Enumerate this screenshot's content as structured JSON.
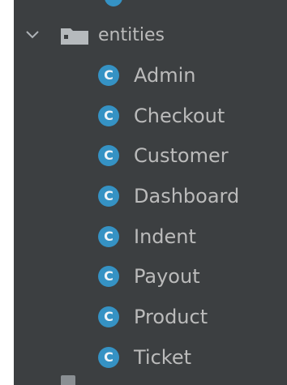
{
  "tree": {
    "folder": {
      "label": "entities",
      "expanded": true,
      "icon": "folder-icon"
    },
    "class_badge_letter": "C",
    "classes": [
      {
        "label": "Admin"
      },
      {
        "label": "Checkout"
      },
      {
        "label": "Customer"
      },
      {
        "label": "Dashboard"
      },
      {
        "label": "Indent"
      },
      {
        "label": "Payout"
      },
      {
        "label": "Product"
      },
      {
        "label": "Ticket"
      }
    ]
  },
  "colors": {
    "panel_background": "#3c3f41",
    "text": "#bbbbbb",
    "class_icon": "#3592c4"
  }
}
